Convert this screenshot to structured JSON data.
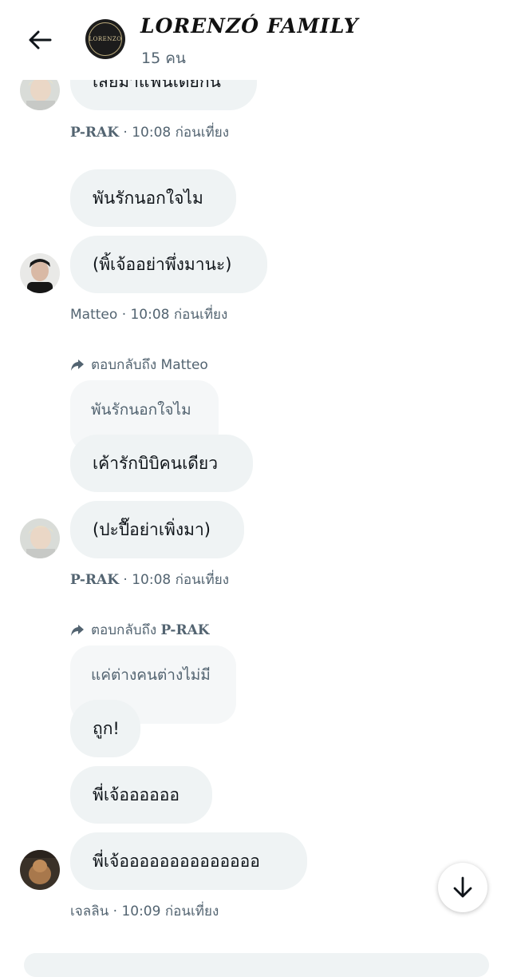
{
  "header": {
    "title": "LORENZÓ FAMILY",
    "member_count": "15 คน",
    "avatar_text": "LORENZO"
  },
  "messages": {
    "m0_text": "เสียมาแฟนเดียกัน",
    "m0_sender": "P-RAK",
    "m0_time": "· 10:08 ก่อนเที่ยง",
    "m1_text": "พันรักนอกใจไม",
    "m2_text": "(พิ้เจ้ออย่าพึ่งมานะ)",
    "m2_sender": "Matteo",
    "m2_time": "· 10:08 ก่อนเที่ยง",
    "r1_prefix": "ตอบกลับถึง",
    "r1_name": "Matteo",
    "r1_quote": "พันรักนอกใจไม",
    "m3_text": "เค้ารักบิบิคนเดียว",
    "m4_text": "(ปะปื๊อย่าเพิ่งมา)",
    "m4_sender": "P-RAK",
    "m4_time": "· 10:08 ก่อนเที่ยง",
    "r2_prefix": "ตอบกลับถึง",
    "r2_name": "P-RAK",
    "r2_quote": "แค่ต่างคนต่างไม่มี",
    "m5_text": "ถูก!",
    "m6_text": "พี่เจ้ออออออ",
    "m7_text": "พี่เจ้ออออออออออออออ",
    "m7_sender": "เจลลิน",
    "m7_time": "· 10:09 ก่อนเที่ยง"
  },
  "colors": {
    "bubble": "#eff3f4",
    "meta": "#536471",
    "text": "#0f1419"
  }
}
